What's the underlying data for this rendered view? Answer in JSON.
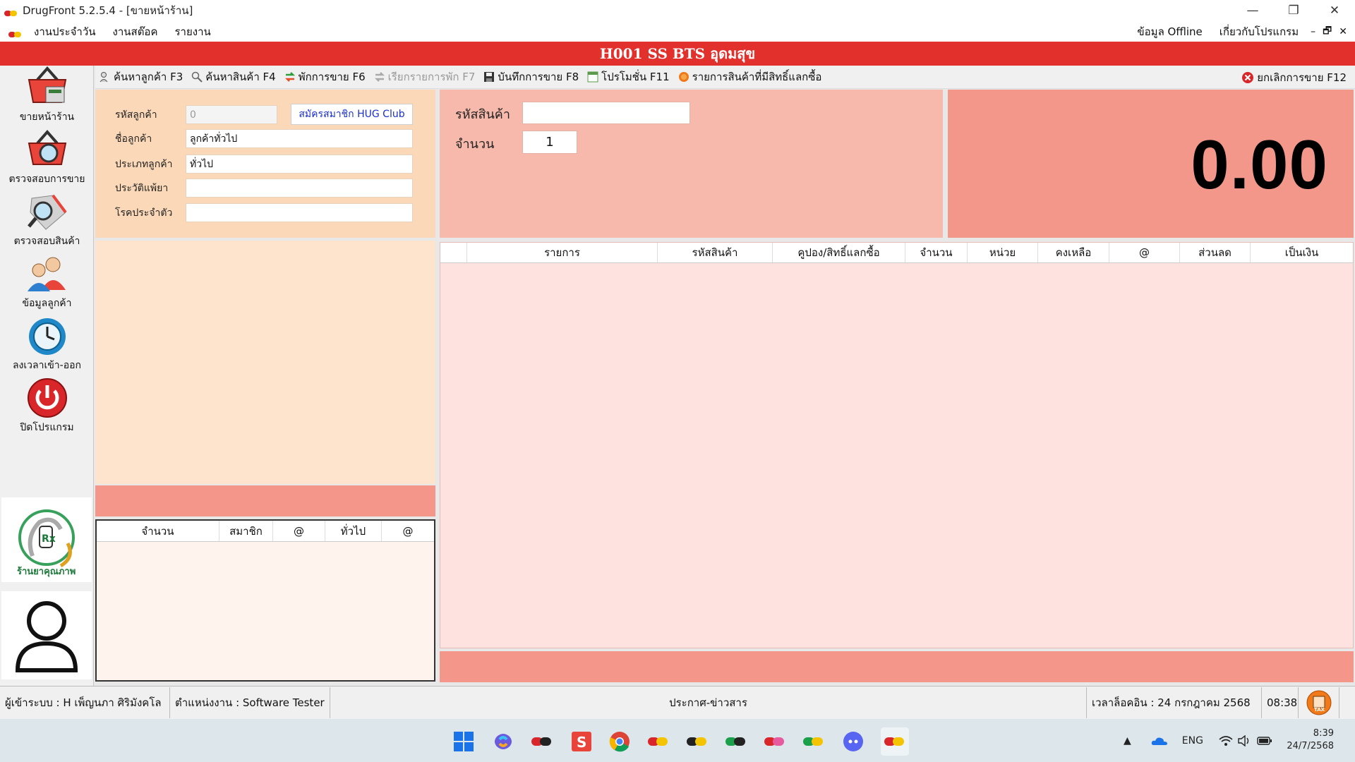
{
  "window": {
    "title": "DrugFront 5.2.5.4 - [ขายหน้าร้าน]",
    "controls": [
      "—",
      "❐",
      "✕"
    ]
  },
  "menu": {
    "items": [
      "งานประจำวัน",
      "งานสต๊อค",
      "รายงาน"
    ],
    "right_items": [
      "ข้อมูล Offline",
      "เกี่ยวกับโปรแกรม"
    ],
    "mdi_controls": [
      "–",
      "🗗",
      "✕"
    ]
  },
  "branch": {
    "title": "H001 SS BTS อุดมสุข"
  },
  "sidebar": {
    "items": [
      {
        "label": "ขายหน้าร้าน",
        "icon": "basket-register-icon"
      },
      {
        "label": "ตรวจสอบการขาย",
        "icon": "basket-search-icon"
      },
      {
        "label": "ตรวจสอบสินค้า",
        "icon": "product-search-icon"
      },
      {
        "label": "ข้อมูลลูกค้า",
        "icon": "customers-icon"
      },
      {
        "label": "ลงเวลาเข้า-ออก",
        "icon": "clock-icon"
      },
      {
        "label": "ปิดโปรแกรม",
        "icon": "power-icon"
      }
    ],
    "logo_text": "ร้านยาคุณภาพ"
  },
  "toolbar": {
    "buttons": [
      {
        "label": "ค้นหาลูกค้า F3",
        "icon": "customer-search-icon",
        "enabled": true
      },
      {
        "label": "ค้นหาสินค้า F4",
        "icon": "search-icon",
        "enabled": true
      },
      {
        "label": "พักการขาย F6",
        "icon": "hold-icon",
        "enabled": true
      },
      {
        "label": "เรียกรายการพัก F7",
        "icon": "recall-icon",
        "enabled": false
      },
      {
        "label": "บันทึกการขาย F8",
        "icon": "save-icon",
        "enabled": true
      },
      {
        "label": "โปรโมชั่น F11",
        "icon": "promotion-icon",
        "enabled": true
      },
      {
        "label": "รายการสินค้าที่มีสิทธิ์แลกซื้อ",
        "icon": "redeem-icon",
        "enabled": true
      }
    ],
    "cancel_label": "ยกเลิกการขาย F12"
  },
  "customer": {
    "code_label": "รหัสลูกค้า",
    "code_value": "0",
    "hug_button": "สมัครสมาชิก HUG Club",
    "name_label": "ชื่อลูกค้า",
    "name_value": "ลูกค้าทั่วไป",
    "type_label": "ประเภทลูกค้า",
    "type_value": "ทั่วไป",
    "allergy_label": "ประวัติแพ้ยา",
    "allergy_value": "",
    "disease_label": "โรคประจำตัว",
    "disease_value": ""
  },
  "price_table": {
    "columns": [
      "จำนวน",
      "สมาชิก",
      "@",
      "ทั่วไป",
      "@"
    ]
  },
  "product_entry": {
    "code_label": "รหัสสินค้า",
    "code_value": "",
    "qty_label": "จำนวน",
    "qty_value": "1"
  },
  "total": {
    "value": "0.00"
  },
  "items_grid": {
    "columns": [
      "รายการ",
      "รหัสสินค้า",
      "คูปอง/สิทธิ์แลกซื้อ",
      "จำนวน",
      "หน่วย",
      "คงเหลือ",
      "@",
      "ส่วนลด",
      "เป็นเงิน"
    ]
  },
  "status": {
    "user": "ผู้เข้าระบบ : H เพ็ญนภา ศิริมังคโล",
    "position": "ตำแหน่งงาน : Software Tester",
    "news": "ประกาศ-ข่าวสาร",
    "login_time": "เวลาล็อคอิน : 24  กรกฎาคม  2568",
    "time": "08:38",
    "tax_icon_label": "TAX"
  },
  "taskbar": {
    "language": "ENG",
    "time": "8:39",
    "date": "24/7/2568"
  },
  "colors": {
    "brand_red": "#e2302c",
    "customer_bg": "#fbd9b8",
    "product_bg": "#f7b9ab",
    "total_bg": "#f2978a",
    "grid_bg": "#fde2df"
  }
}
